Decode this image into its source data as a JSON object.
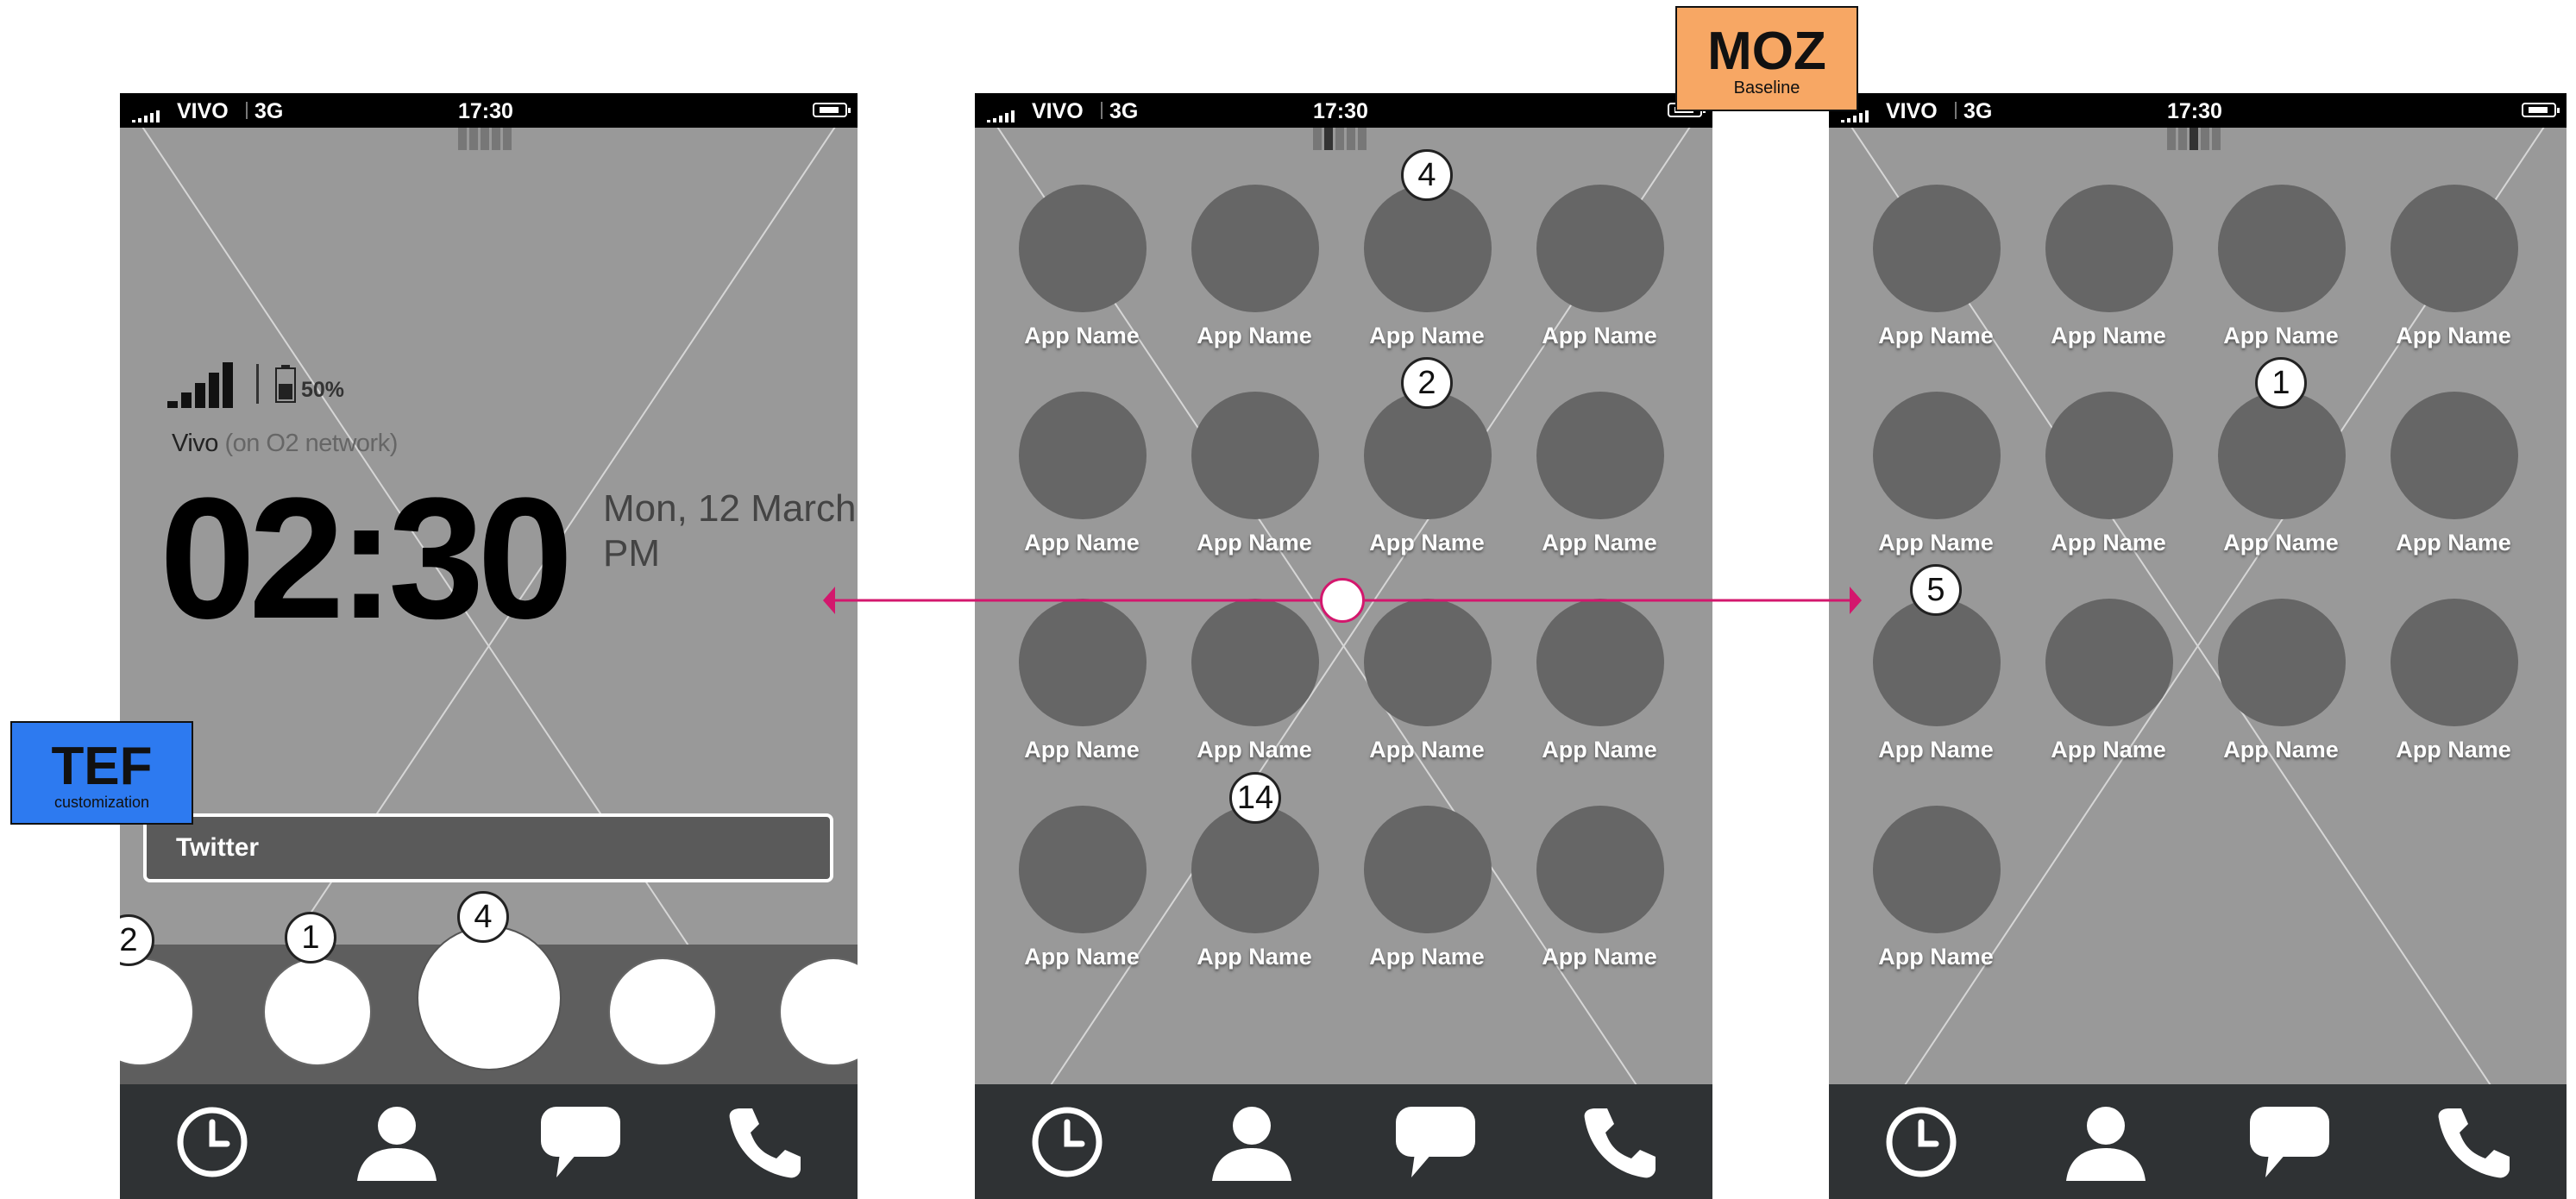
{
  "tags": {
    "moz": {
      "title": "MOZ",
      "subtitle": "Baseline",
      "color": "#f7a764"
    },
    "tef": {
      "title": "TEF",
      "subtitle": "customization",
      "color": "#2d7af0"
    }
  },
  "accent_color": "#d3176d",
  "status_bar": {
    "carrier": "VIVO",
    "network": "3G",
    "time": "17:30"
  },
  "lockscreen": {
    "battery": "50%",
    "carrier": "Vivo",
    "network_note": "(on O2 network)",
    "clock": "02:30",
    "date_line1": "Mon, 12 March",
    "date_line2": "PM",
    "notification": "Twitter",
    "carousel_badges": [
      "2",
      "1",
      "4"
    ]
  },
  "homescreen_middle": {
    "apps": [
      "App Name",
      "App Name",
      "App Name",
      "App Name",
      "App Name",
      "App Name",
      "App Name",
      "App Name",
      "App Name",
      "App Name",
      "App Name",
      "App Name",
      "App Name",
      "App Name",
      "App Name",
      "App Name"
    ],
    "badges": [
      "4",
      "2",
      "14"
    ]
  },
  "homescreen_right": {
    "apps": [
      "App Name",
      "App Name",
      "App Name",
      "App Name",
      "App Name",
      "App Name",
      "App Name",
      "App Name",
      "App Name",
      "App Name",
      "App Name",
      "App Name",
      "App Name"
    ],
    "badges": [
      "1",
      "5"
    ]
  },
  "dock": [
    {
      "icon": "clock-icon"
    },
    {
      "icon": "contacts-icon"
    },
    {
      "icon": "messages-icon"
    },
    {
      "icon": "phone-icon"
    }
  ]
}
